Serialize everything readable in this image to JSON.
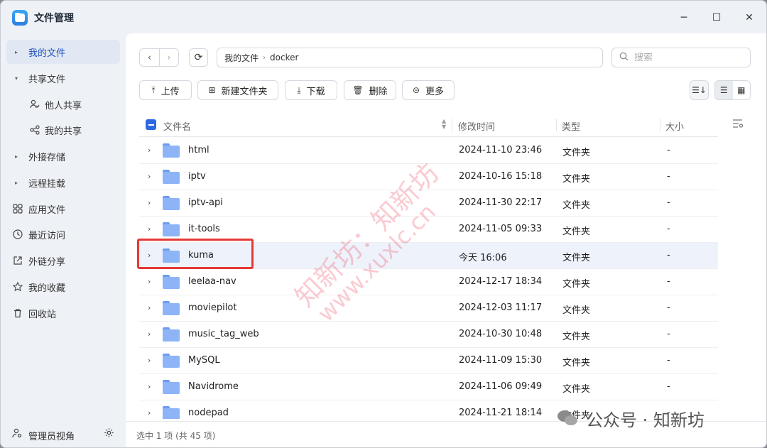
{
  "window": {
    "title": "文件管理",
    "minimize": "─",
    "maximize": "☐",
    "close": "✕"
  },
  "sidebar": {
    "items": [
      {
        "label": "我的文件",
        "active": true,
        "caret": "▸",
        "icon": ""
      },
      {
        "label": "共享文件",
        "caret": "▾",
        "icon": ""
      },
      {
        "label": "他人共享",
        "sub": true,
        "icon": "shared-with-me-icon"
      },
      {
        "label": "我的共享",
        "sub": true,
        "icon": "share-icon"
      },
      {
        "label": "外接存储",
        "caret": "▸",
        "icon": ""
      },
      {
        "label": "远程挂载",
        "caret": "▸",
        "icon": ""
      },
      {
        "label": "应用文件",
        "icon": "apps-icon"
      },
      {
        "label": "最近访问",
        "icon": "clock-icon"
      },
      {
        "label": "外链分享",
        "icon": "external-link-icon"
      },
      {
        "label": "我的收藏",
        "icon": "star-icon"
      },
      {
        "label": "回收站",
        "icon": "trash-icon"
      }
    ],
    "admin_label": "管理员视角"
  },
  "pathbar": {
    "root": "我的文件",
    "current": "docker"
  },
  "search": {
    "placeholder": "搜索"
  },
  "toolbar": {
    "upload": "上传",
    "new_folder": "新建文件夹",
    "download": "下载",
    "delete": "删除",
    "more": "更多"
  },
  "table": {
    "headers": {
      "name": "文件名",
      "modified": "修改时间",
      "type": "类型",
      "size": "大小"
    },
    "rows": [
      {
        "name": "html",
        "modified": "2024-11-10 23:46",
        "type": "文件夹",
        "size": "-"
      },
      {
        "name": "iptv",
        "modified": "2024-10-16 15:18",
        "type": "文件夹",
        "size": "-"
      },
      {
        "name": "iptv-api",
        "modified": "2024-11-30 22:17",
        "type": "文件夹",
        "size": "-"
      },
      {
        "name": "it-tools",
        "modified": "2024-11-05 09:33",
        "type": "文件夹",
        "size": "-"
      },
      {
        "name": "kuma",
        "modified": "今天 16:06",
        "type": "文件夹",
        "size": "-",
        "selected": true
      },
      {
        "name": "leelaa-nav",
        "modified": "2024-12-17 18:34",
        "type": "文件夹",
        "size": "-"
      },
      {
        "name": "moviepilot",
        "modified": "2024-12-03 11:17",
        "type": "文件夹",
        "size": "-"
      },
      {
        "name": "music_tag_web",
        "modified": "2024-10-30 10:48",
        "type": "文件夹",
        "size": "-"
      },
      {
        "name": "MySQL",
        "modified": "2024-11-09 15:30",
        "type": "文件夹",
        "size": "-"
      },
      {
        "name": "Navidrome",
        "modified": "2024-11-06 09:49",
        "type": "文件夹",
        "size": "-"
      },
      {
        "name": "nodepad",
        "modified": "2024-11-21 18:14",
        "type": "文件夹",
        "size": "-"
      }
    ]
  },
  "status": {
    "text": "选中 1 项 (共 45 项)"
  },
  "watermark": {
    "line1": "知新坊：知新坊",
    "line2": "www.xuxlc.cn",
    "corner": "公众号 · 知新坊"
  },
  "colors": {
    "accent": "#2c68e0",
    "highlight_box": "#e53935",
    "folder": "#8cb4f7"
  }
}
